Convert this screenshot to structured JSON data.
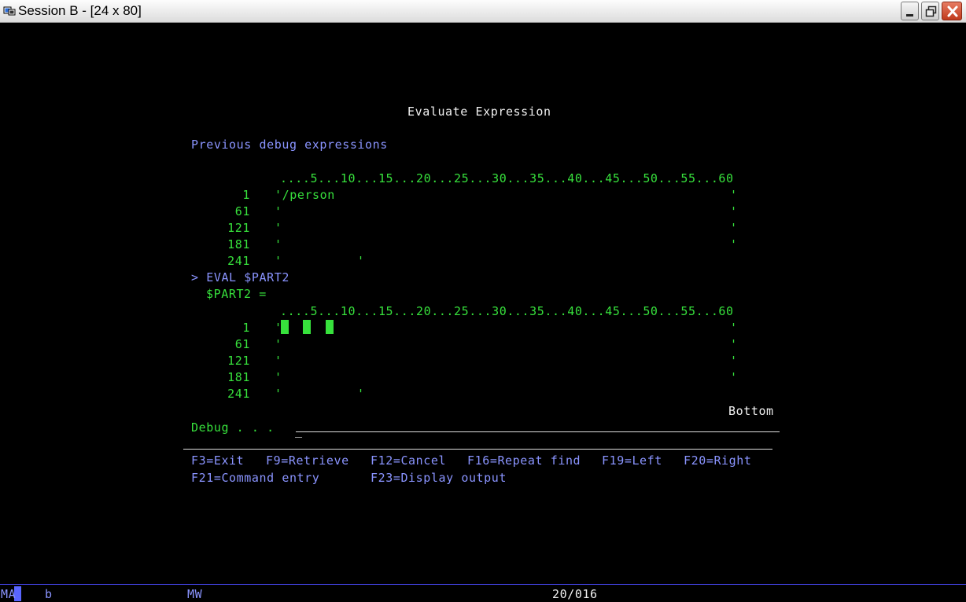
{
  "window": {
    "title": "Session B - [24 x 80]",
    "minimize_label": "minimize",
    "maximize_label": "maximize",
    "close_label": "close"
  },
  "screen": {
    "heading": "Evaluate Expression",
    "section_label": "Previous debug expressions",
    "ruler1": "....5...10...15...20...25...30...35...40...45...50...55...60",
    "block1": {
      "rows": [
        {
          "num": "1",
          "content": "'/person"
        },
        {
          "num": "61",
          "content": "'"
        },
        {
          "num": "121",
          "content": "'"
        },
        {
          "num": "181",
          "content": "'"
        },
        {
          "num": "241",
          "content": "'"
        }
      ],
      "end_quote": "'",
      "end_quote_241": "'"
    },
    "command": "> EVAL $PART2",
    "result_label": "$PART2 =",
    "ruler2": "....5...10...15...20...25...30...35...40...45...50...55...60",
    "block2": {
      "rows": [
        {
          "num": "1",
          "content": "'"
        },
        {
          "num": "61",
          "content": "'"
        },
        {
          "num": "121",
          "content": "'"
        },
        {
          "num": "181",
          "content": "'"
        },
        {
          "num": "241",
          "content": "'"
        }
      ],
      "end_quote": "'",
      "end_quote_241": "'"
    },
    "bottom_label": "Bottom",
    "debug_label": "Debug . . .",
    "debug_input_value": "_",
    "function_keys_row1": [
      "F3=Exit",
      "F9=Retrieve",
      "F12=Cancel",
      "F16=Repeat find",
      "F19=Left",
      "F20=Right"
    ],
    "function_keys_row2": [
      "F21=Command entry",
      "F23=Display output"
    ]
  },
  "status": {
    "mode": "MA",
    "session": "b",
    "mw": "MW",
    "cursor_pos": "20/016"
  },
  "colors": {
    "green": "#37e13c",
    "white": "#f2f2f2",
    "blue": "#8a94ff",
    "background": "#000000"
  }
}
